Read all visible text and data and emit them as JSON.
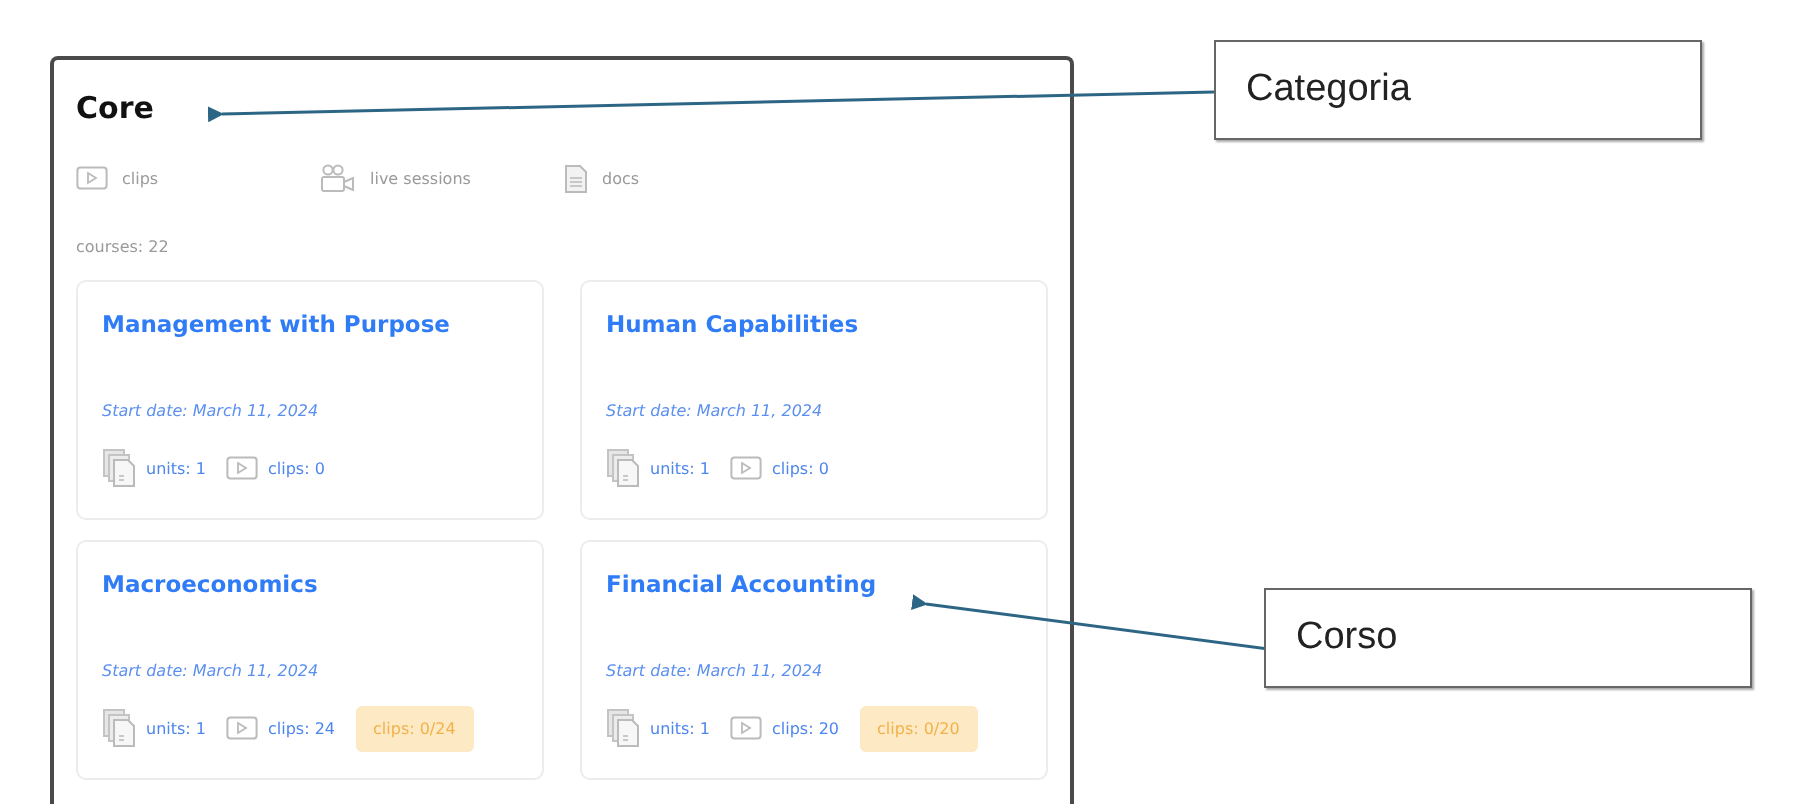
{
  "category": {
    "title": "Core",
    "content_types": [
      {
        "kind": "clips",
        "label": "clips"
      },
      {
        "kind": "live",
        "label": "live sessions"
      },
      {
        "kind": "docs",
        "label": "docs"
      }
    ],
    "course_count": "courses: 22",
    "courses": [
      {
        "title": "Management with Purpose",
        "start_date": "Start date: March 11, 2024",
        "units": "units: 1",
        "clips": "clips: 0"
      },
      {
        "title": "Human Capabilities",
        "start_date": "Start date: March 11, 2024",
        "units": "units: 1",
        "clips": "clips: 0"
      },
      {
        "title": "Macroeconomics",
        "start_date": "Start date: March 11, 2024",
        "units": "units: 1",
        "clips": "clips: 24",
        "progress": "clips: 0/24"
      },
      {
        "title": "Financial Accounting",
        "start_date": "Start date: March 11, 2024",
        "units": "units: 1",
        "clips": "clips: 20",
        "progress": "clips: 0/20"
      }
    ]
  },
  "annotations": [
    {
      "label": "Categoria",
      "kind": "category"
    },
    {
      "label": "Corso",
      "kind": "course"
    }
  ]
}
